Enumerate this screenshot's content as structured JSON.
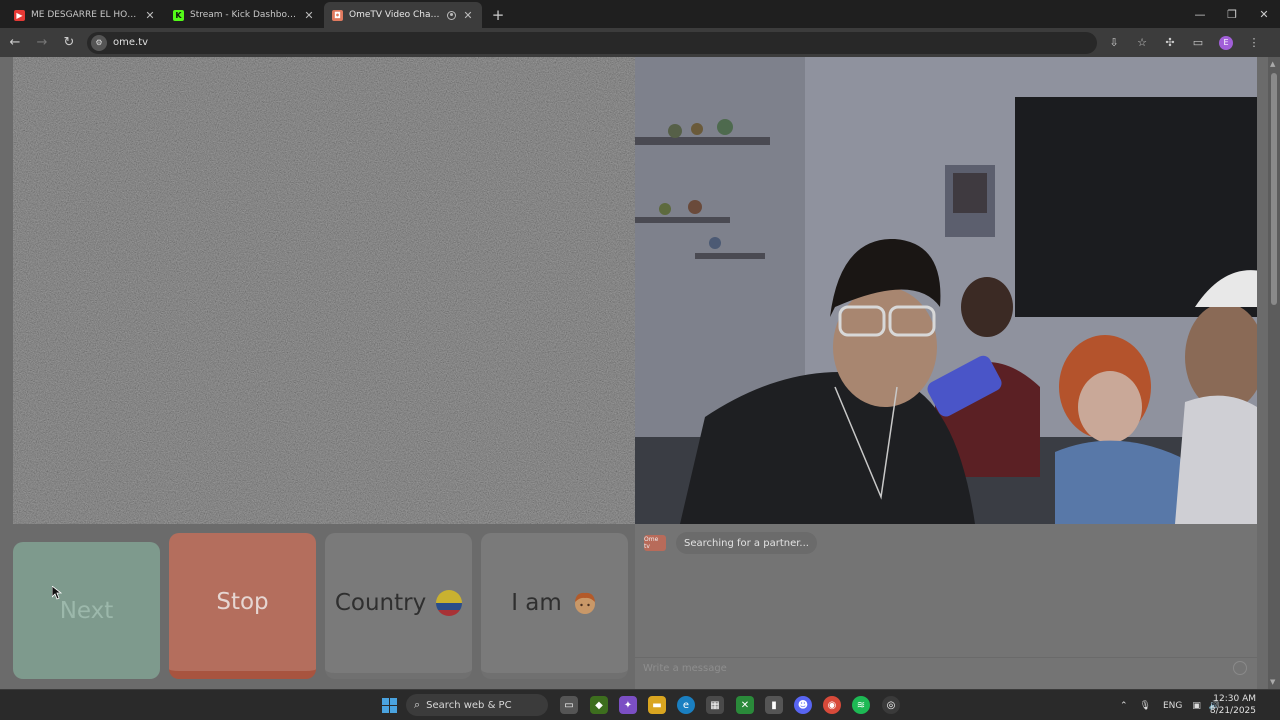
{
  "browser": {
    "tabs": [
      {
        "title": "ME DESGARRÉ EL HOMBRO - T",
        "favicon": "youtube-icon",
        "color": "#e53935",
        "active": false
      },
      {
        "title": "Stream - Kick Dashboard",
        "favicon": "kick-icon",
        "color": "#53fc18",
        "active": false
      },
      {
        "title": "OmeTV Video Chat — Ome",
        "favicon": "ometv-icon",
        "color": "#e07a5f",
        "active": true
      }
    ],
    "new_tab_label": "+",
    "url": "ome.tv",
    "profile_initial": "E"
  },
  "controls": {
    "next_label": "Next",
    "stop_label": "Stop",
    "country_label": "Country",
    "country_flag": "colombia-flag-icon",
    "iam_label": "I am",
    "iam_icon": "boy-face-icon"
  },
  "chat": {
    "logo_text": "Ome tv",
    "status_message": "Searching for a partner...",
    "input_placeholder": "Write a message"
  },
  "taskbar": {
    "search_placeholder": "Search web & PC",
    "language": "ENG",
    "time": "12:30 AM",
    "date": "8/21/2025"
  }
}
